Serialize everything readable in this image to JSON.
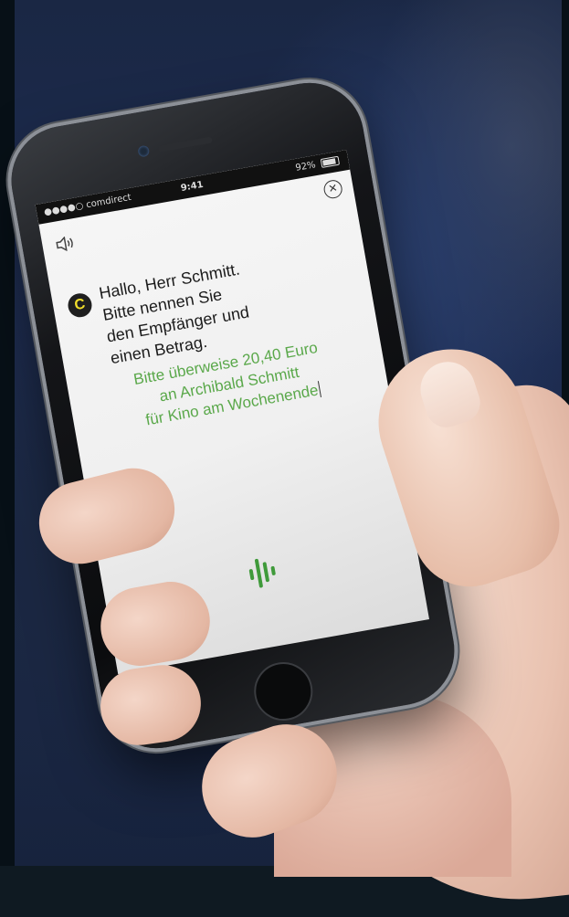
{
  "status_bar": {
    "carrier": "●●●●○ comdirect",
    "time": "9:41",
    "battery": "92%"
  },
  "assistant": {
    "logo_letter": "C",
    "greeting_lines": [
      "Hallo, Herr Schmitt.",
      "Bitte nennen Sie",
      "den Empfänger und",
      "einen Betrag."
    ]
  },
  "user_speech": {
    "lines": [
      "Bitte überweise 20,40 Euro",
      "an Archibald Schmitt",
      "für Kino am Wochenende"
    ]
  },
  "icons": {
    "close": "close-icon",
    "speaker": "speaker-icon",
    "mic": "voice-wave-icon"
  },
  "colors": {
    "accent_green": "#5aa84a",
    "logo_yellow": "#f2df2b"
  }
}
